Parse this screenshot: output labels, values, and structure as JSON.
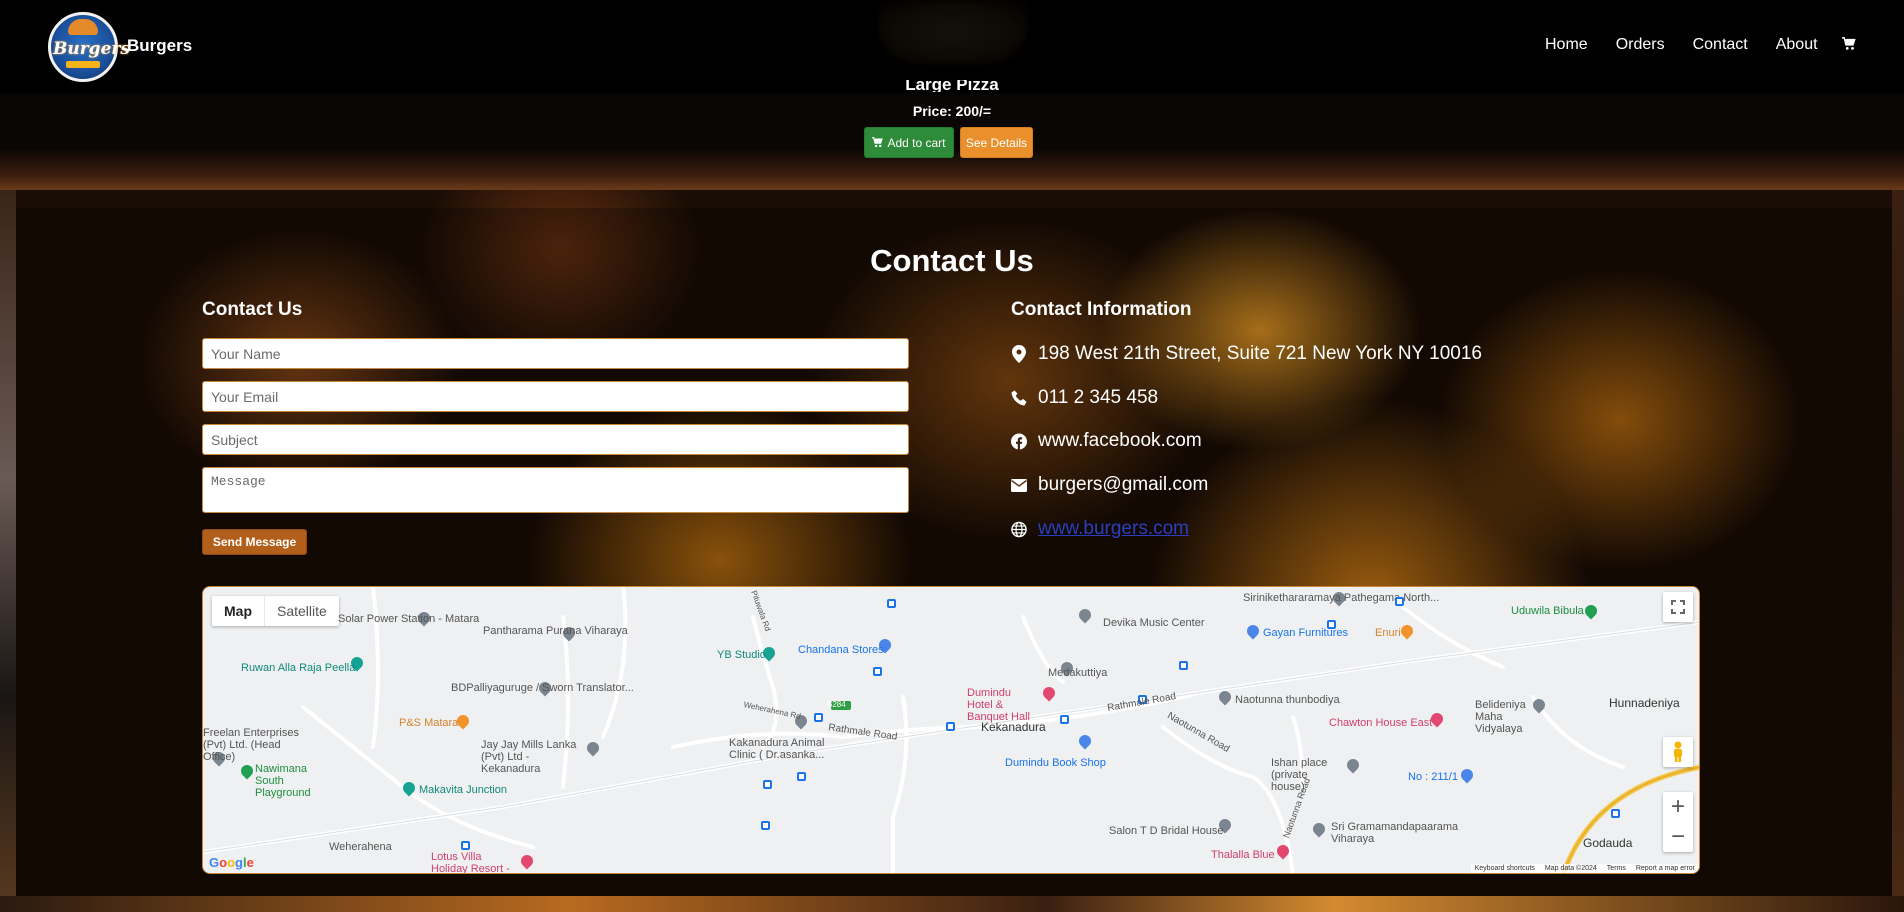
{
  "navbar": {
    "brand_logo_text": "Burgers",
    "brand_name": "Burgers",
    "links": [
      "Home",
      "Orders",
      "Contact",
      "About"
    ],
    "cart_icon": "shopping-cart-icon"
  },
  "product": {
    "name": "Large Pizza",
    "price": "Price: 200/=",
    "add_to_cart_label": "Add to cart",
    "details_label": "See Details"
  },
  "contact": {
    "section_title": "Contact Us",
    "form_title": "Contact Us",
    "name_placeholder": "Your Name",
    "email_placeholder": "Your Email",
    "subject_placeholder": "Subject",
    "message_placeholder": "Message",
    "send_label": "Send Message"
  },
  "info": {
    "title": "Contact Information",
    "address": "198 West 21th Street, Suite 721 New York NY 10016",
    "phone": "011 2 345 458",
    "facebook": "www.facebook.com",
    "email": "burgers@gmail.com",
    "website": "www.burgers.com"
  },
  "map": {
    "map_label": "Map",
    "satellite_label": "Satellite",
    "places": [
      "Solar Power Station - Matara",
      "Pantharama Purana Viharaya",
      "Ruwan Alla Raja Peella",
      "BDPalliyaguruge / Sworn Translator...",
      "YB Studio",
      "Chandana Stores",
      "Medakuttiya",
      "Devika Music Center",
      "Sirinikethararamaya Pathegama North...",
      "Gayan Furnitures",
      "Enuri",
      "Uduwila Bibula",
      "Dumindu Hotel & Banquet Hall",
      "Naotunna thunbodiya",
      "Hunnadeniya",
      "Freelan Enterprises (Pvt) Ltd. (Head Office)",
      "P&S Matara",
      "Jay Jay Mills Lanka (Pvt) Ltd - Kekanadura",
      "Kakanadura Animal Clinic ( Dr.asanka...",
      "Kekanadura",
      "Chawton House East",
      "Belideniya Maha Vidyalaya",
      "Nawimana South Playground",
      "Makavita Junction",
      "Dumindu Book Shop",
      "Ishan place (private house)",
      "No : 211/1",
      "Salon T D Bridal House",
      "Sri Gramamandapaarama Viharaya",
      "Godauda",
      "Weherahena",
      "Lotus Villa Holiday Resort - Makawita",
      "Thalalla Blue"
    ],
    "roads": [
      "Rathmale Road",
      "Rathmale Road",
      "Naotunna Road",
      "Naotunna Road",
      "Weherahena Rd",
      "Pituwala Rd",
      "B284"
    ],
    "google_logo": "Google",
    "attribution": [
      "Keyboard shortcuts",
      "Map data ©2024",
      "Terms",
      "Report a map error"
    ]
  },
  "colors": {
    "add_to_cart": "#2e8b3a",
    "see_details": "#e9902c",
    "send_button": "#b35f1c",
    "link": "#2a3fc0"
  }
}
